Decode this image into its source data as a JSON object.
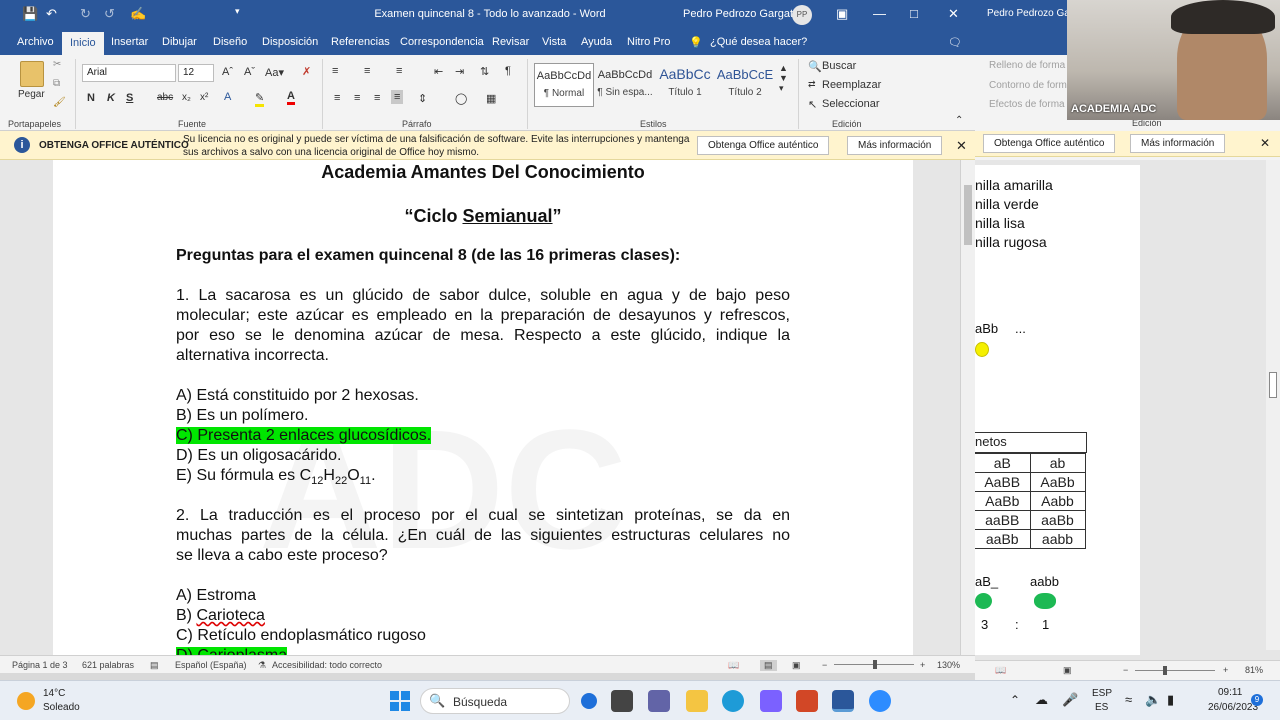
{
  "window": {
    "title": "Examen quincenal 8 - Todo lo avanzado  -  Word",
    "user": "Pedro Pedrozo Gargate",
    "user_initials": "PP"
  },
  "menu": {
    "tabs": [
      "Archivo",
      "Inicio",
      "Insertar",
      "Dibujar",
      "Diseño",
      "Disposición",
      "Referencias",
      "Correspondencia",
      "Revisar",
      "Vista",
      "Ayuda",
      "Nitro Pro"
    ],
    "active_tab": "Inicio",
    "tell_me": "¿Qué desea hacer?"
  },
  "ribbon": {
    "paste_label": "Pegar",
    "font_name": "Arial",
    "font_size": "12",
    "styles": [
      {
        "preview": "AaBbCcDd",
        "name": "¶ Normal"
      },
      {
        "preview": "AaBbCcDd",
        "name": "¶ Sin espa..."
      },
      {
        "preview": "AaBbCc",
        "name": "Título 1"
      },
      {
        "preview": "AaBbCcE",
        "name": "Título 2"
      }
    ],
    "editing": {
      "find": "Buscar",
      "replace": "Reemplazar",
      "select": "Seleccionar"
    },
    "groups": {
      "clipboard": "Portapapeles",
      "font": "Fuente",
      "paragraph": "Párrafo",
      "styles": "Estilos",
      "editing": "Edición"
    }
  },
  "notice": {
    "title": "OBTENGA OFFICE AUTÉNTICO",
    "line1": "Su licencia no es original y puede ser víctima de una falsificación de software. Evite las interrupciones y mantenga",
    "line2": "sus archivos a salvo con una licencia original de Office hoy mismo.",
    "btn_get": "Obtenga Office auténtico",
    "btn_more": "Más información"
  },
  "document": {
    "heading": "Academia Amantes Del Conocimiento",
    "subheading_open": "“Ciclo ",
    "subheading_word": "Semianual",
    "subheading_close": "”",
    "section_title": "Preguntas para el examen quincenal 8 (de las 16 primeras clases):",
    "q1": {
      "lines": [
        "1. La sacarosa es un glúcido de sabor dulce, soluble en agua y de bajo peso",
        "molecular; este azúcar es empleado en la preparación de desayunos y refrescos,",
        "por eso se le denomina azúcar de mesa. Respecto a este glúcido, indique la",
        "alternativa incorrecta."
      ],
      "options": {
        "a": "A) Está constituido por 2 hexosas.",
        "b": "B) Es un polímero.",
        "c": "C) Presenta 2 enlaces glucosídicos.",
        "d": "D) Es un oligosacárido.",
        "e_prefix": "E) Su fórmula es C",
        "e_sub1": "12",
        "e_h": "H",
        "e_sub2": "22",
        "e_o": "O",
        "e_sub3": "11",
        "e_suffix": "."
      }
    },
    "q2": {
      "lines": [
        "2. La traducción es el proceso por el cual se sintetizan proteínas, se da en",
        "muchas partes de la célula. ¿En cuál de las siguientes estructuras celulares no",
        "se lleva a cabo este proceso?"
      ],
      "options": {
        "a": "A) Estroma",
        "b_prefix": "B) ",
        "b_word": "Carioteca",
        "c": "C) Retículo endoplasmático rugoso",
        "d_prefix": "D) ",
        "d_word": "Carioplasma"
      }
    }
  },
  "status": {
    "page": "Página 1 de 3",
    "words": "621 palabras",
    "language": "Español (España)",
    "accessibility": "Accesibilidad: todo correcto",
    "zoom": "130%"
  },
  "right_window": {
    "user": "Pedro Pedrozo Ga",
    "gray_items": [
      "Relleno de forma",
      "Contorno de forma",
      "Efectos de forma"
    ],
    "editing_label": "Edición",
    "notice_btn_get": "Obtenga Office auténtico",
    "notice_btn_more": "Más información",
    "doc_lines": [
      "nilla amarilla",
      "nilla verde",
      "nilla lisa",
      "nilla rugosa"
    ],
    "aBb": "aBb",
    "ellipsis": "...",
    "table_header": "netos",
    "table_cols": [
      "aB",
      "ab"
    ],
    "table_rows": [
      [
        "AaBB",
        "AaBb"
      ],
      [
        "AaBb",
        "Aabb"
      ],
      [
        "aaBB",
        "aaBb"
      ],
      [
        "aaBb",
        "aabb"
      ]
    ],
    "pheno1": "aB_",
    "pheno2": "aabb",
    "ratio_left": "3",
    "ratio_colon": ":",
    "ratio_right": "1",
    "zoom": "81%"
  },
  "webcam": {
    "label": "ACADEMIA ADC"
  },
  "taskbar": {
    "temp": "14°C",
    "weather": "Soleado",
    "search": "Búsqueda",
    "lang1": "ESP",
    "lang2": "ES",
    "time": "09:11",
    "date": "26/06/2023",
    "notif": "9"
  },
  "colors": {
    "word_blue": "#2b579a",
    "highlight_green": "#00e600",
    "notice_yellow": "#fff4ce"
  }
}
